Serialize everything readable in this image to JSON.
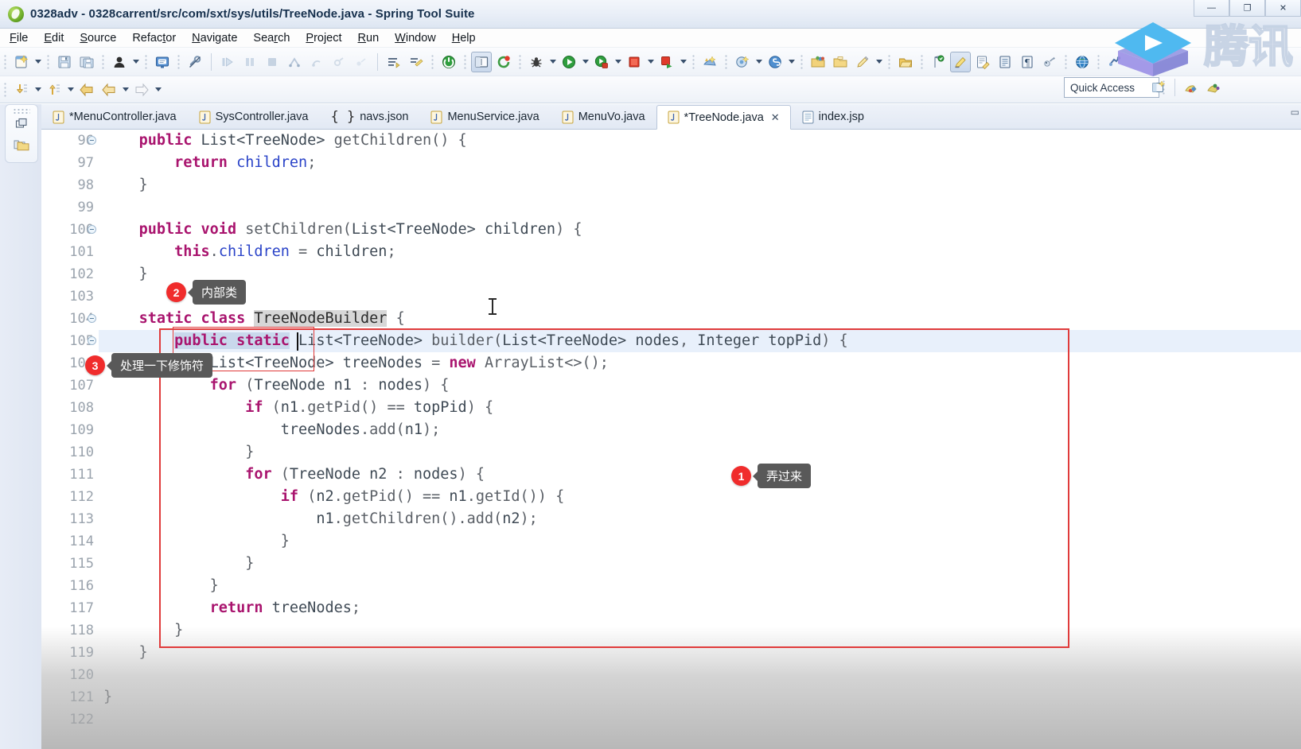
{
  "window": {
    "title": "0328adv - 0328carrent/src/com/sxt/sys/utils/TreeNode.java - Spring Tool Suite",
    "app_icon": "spring-leaf-icon",
    "buttons": [
      {
        "name": "minimize",
        "glyph": "—"
      },
      {
        "name": "maximize",
        "glyph": "❐"
      },
      {
        "name": "close",
        "glyph": "✕"
      }
    ]
  },
  "menubar": {
    "items": [
      {
        "label": "File",
        "mnemonic": "F"
      },
      {
        "label": "Edit",
        "mnemonic": "E"
      },
      {
        "label": "Source",
        "mnemonic": "S"
      },
      {
        "label": "Refactor",
        "mnemonic": "t"
      },
      {
        "label": "Navigate",
        "mnemonic": "N"
      },
      {
        "label": "Search",
        "mnemonic": "r"
      },
      {
        "label": "Project",
        "mnemonic": "P"
      },
      {
        "label": "Run",
        "mnemonic": "R"
      },
      {
        "label": "Window",
        "mnemonic": "W"
      },
      {
        "label": "Help",
        "mnemonic": "H"
      }
    ]
  },
  "toolbar": {
    "quick_access": "Quick Access",
    "row1_icons": [
      "new-wizard-icon",
      "save-icon",
      "save-all-icon",
      "user-account-icon",
      "open-console-icon",
      "link-break-icon",
      "skip-breakpoints-icon",
      "step-over-icon",
      "resume-icon",
      "terminate-icon",
      "step-into-icon",
      "step-return-icon",
      "disconnect-icon",
      "open-type-icon",
      "search-icon",
      "next-annotation-icon",
      "power-icon",
      "toggle-view-icon",
      "refresh-icon",
      "debug-icon",
      "run-icon",
      "run-coverage-icon",
      "stop-icon",
      "run-external-icon",
      "build-icon",
      "boot-dashboard-icon",
      "spring-icon",
      "packages-icon",
      "open-folder-icon",
      "edit-pencil-icon",
      "open-project-icon",
      "marker-icon",
      "highlight-icon",
      "edit-doc-icon",
      "properties-icon",
      "pilcrow-icon",
      "remote-icon",
      "browser-icon",
      "perspective-icon"
    ],
    "row2_icons": [
      "step-down-icon",
      "step-up-icon",
      "back-icon",
      "forward-back-icon",
      "forward-icon"
    ],
    "right_icons": [
      "open-perspective-icon",
      "java-perspective-icon",
      "java-ee-perspective-icon"
    ]
  },
  "watermark": {
    "logo": "play-button-logo",
    "text": "腾讯"
  },
  "minibar": {
    "items": [
      {
        "icon": "restore-view-icon"
      },
      {
        "icon": "package-explorer-icon"
      }
    ]
  },
  "tabs": [
    {
      "label": "*MenuController.java",
      "icon": "java-file-icon",
      "active": false,
      "dirty": true
    },
    {
      "label": "SysController.java",
      "icon": "java-file-icon",
      "active": false,
      "dirty": false
    },
    {
      "label": "navs.json",
      "icon": "json-file-icon",
      "active": false,
      "dirty": false
    },
    {
      "label": "MenuService.java",
      "icon": "java-file-icon",
      "active": false,
      "dirty": false
    },
    {
      "label": "MenuVo.java",
      "icon": "java-file-icon",
      "active": false,
      "dirty": false
    },
    {
      "label": "*TreeNode.java",
      "icon": "java-file-icon",
      "active": true,
      "dirty": true,
      "close": "✕"
    },
    {
      "label": "index.jsp",
      "icon": "jsp-file-icon",
      "active": false,
      "dirty": false
    }
  ],
  "editor": {
    "first_line": 96,
    "lines": [
      {
        "n": 96,
        "fold": true,
        "indent": 2,
        "text": "public List<TreeNode> getChildren() {"
      },
      {
        "n": 97,
        "fold": false,
        "indent": 3,
        "text": "return children;"
      },
      {
        "n": 98,
        "fold": false,
        "indent": 2,
        "text": "}"
      },
      {
        "n": 99,
        "fold": false,
        "indent": 0,
        "text": ""
      },
      {
        "n": 100,
        "fold": true,
        "indent": 2,
        "text": "public void setChildren(List<TreeNode> children) {"
      },
      {
        "n": 101,
        "fold": false,
        "indent": 3,
        "text": "this.children = children;"
      },
      {
        "n": 102,
        "fold": false,
        "indent": 2,
        "text": "}"
      },
      {
        "n": 103,
        "fold": false,
        "indent": 0,
        "text": ""
      },
      {
        "n": 104,
        "fold": true,
        "indent": 2,
        "text": "static class TreeNodeBuilder {"
      },
      {
        "n": 105,
        "fold": true,
        "indent": 3,
        "text": "public static List<TreeNode> builder(List<TreeNode> nodes, Integer topPid) {"
      },
      {
        "n": 106,
        "fold": false,
        "indent": 4,
        "text": "List<TreeNode> treeNodes = new ArrayList<>();"
      },
      {
        "n": 107,
        "fold": false,
        "indent": 4,
        "text": "for (TreeNode n1 : nodes) {"
      },
      {
        "n": 108,
        "fold": false,
        "indent": 5,
        "text": "if (n1.getPid() == topPid) {"
      },
      {
        "n": 109,
        "fold": false,
        "indent": 6,
        "text": "treeNodes.add(n1);"
      },
      {
        "n": 110,
        "fold": false,
        "indent": 5,
        "text": "}"
      },
      {
        "n": 111,
        "fold": false,
        "indent": 5,
        "text": "for (TreeNode n2 : nodes) {"
      },
      {
        "n": 112,
        "fold": false,
        "indent": 6,
        "text": "if (n2.getPid() == n1.getId()) {"
      },
      {
        "n": 113,
        "fold": false,
        "indent": 7,
        "text": "n1.getChildren().add(n2);"
      },
      {
        "n": 114,
        "fold": false,
        "indent": 6,
        "text": "}"
      },
      {
        "n": 115,
        "fold": false,
        "indent": 5,
        "text": "}"
      },
      {
        "n": 116,
        "fold": false,
        "indent": 4,
        "text": "}"
      },
      {
        "n": 117,
        "fold": false,
        "indent": 4,
        "text": "return treeNodes;"
      },
      {
        "n": 118,
        "fold": false,
        "indent": 3,
        "text": "}"
      },
      {
        "n": 119,
        "fold": false,
        "indent": 2,
        "text": "}"
      },
      {
        "n": 120,
        "fold": false,
        "indent": 0,
        "text": ""
      },
      {
        "n": 121,
        "fold": false,
        "indent": 1,
        "text": "}"
      },
      {
        "n": 122,
        "fold": false,
        "indent": 0,
        "text": ""
      }
    ],
    "current_line": 105,
    "selection_text": "public static",
    "occurrence_highlight": "TreeNodeBuilder"
  },
  "annotations": [
    {
      "num": "1",
      "text": "弄过来"
    },
    {
      "num": "2",
      "text": "内部类"
    },
    {
      "num": "3",
      "text": "处理一下修饰符"
    }
  ],
  "colors": {
    "keyword": "#a9146e",
    "field": "#2a43c8",
    "type": "#3f4a55",
    "annotation_badge": "#f02c2c",
    "annotation_tip": "#595959",
    "redbox": "#e03b3b",
    "current_line": "#e8f0fb",
    "selection": "#c9d8ec"
  }
}
